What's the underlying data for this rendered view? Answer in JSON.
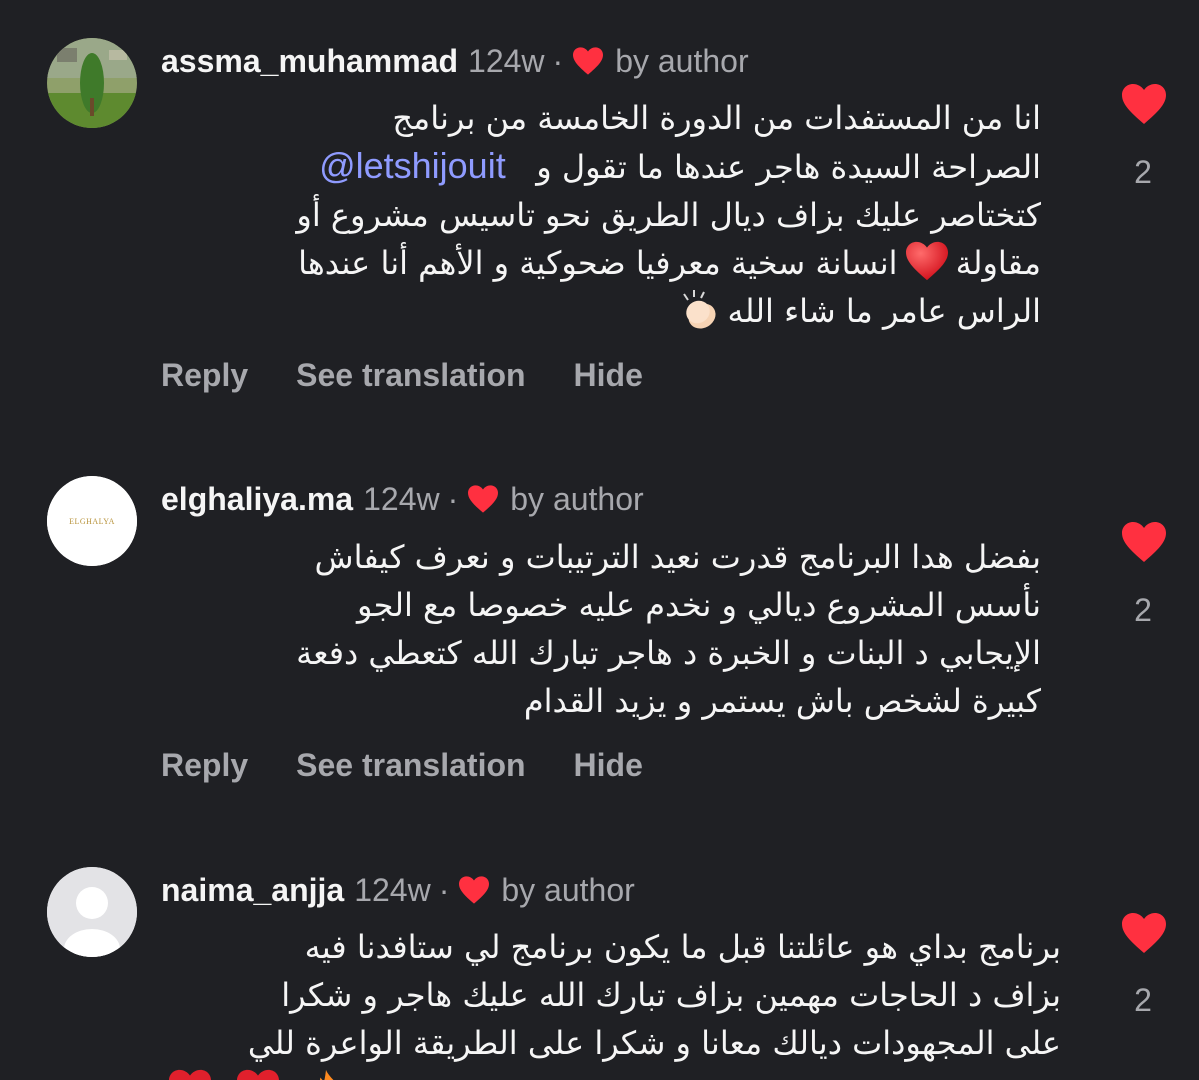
{
  "colors": {
    "background": "#1f2024",
    "text": "#f5f5f5",
    "muted": "#a7a8ad",
    "heart": "#ff3040",
    "mention": "#8f9bff"
  },
  "comments": [
    {
      "username": "assma_muhammad",
      "time": "124w",
      "dot": "·",
      "by_author": "by author",
      "lines": [
        "انا من المستفدات من الدورة الخامسة من برنامج",
        "الصراحة السيدة هاجر عندها ما تقول و",
        "كتختاصر عليك بزاف ديال الطريق نحو تاسيس مشروع أو",
        "انسانة سخية معرفيا ضحوكية و الأهم أنا عندها",
        "الراس عامر ما شاء الله"
      ],
      "mention": "@letshijouit",
      "line4_prefix": "مقاولة",
      "reply": "Reply",
      "translate": "See translation",
      "hide": "Hide",
      "likes": "2",
      "heart_icon": "heart-icon",
      "avatar_icon": "tree-photo-avatar"
    },
    {
      "username": "elghaliya.ma",
      "time": "124w",
      "dot": "·",
      "by_author": "by author",
      "avatar_text": "ELGHALYA",
      "lines": [
        "بفضل هدا البرنامج قدرت نعيد الترتيبات و نعرف كيفاش",
        "نأسس المشروع  ديالي و نخدم عليه خصوصا مع الجو",
        "الإيجابي د البنات و الخبرة د هاجر تبارك الله كتعطي دفعة",
        "كبيرة لشخص باش يستمر و يزيد القدام"
      ],
      "reply": "Reply",
      "translate": "See translation",
      "hide": "Hide",
      "likes": "2"
    },
    {
      "username": "naima_anjja",
      "time": "124w",
      "dot": "·",
      "by_author": "by author",
      "lines": [
        "برنامج بداي هو عائلتنا قبل ما يكون برنامج لي ستافدنا فيه",
        "بزاف د الحاجات مهمين بزاف تبارك الله عليك هاجر و شكرا",
        "على المجهودات ديالك معانا و شكرا على الطريقة الواعرة للي"
      ],
      "likes": "2"
    }
  ]
}
